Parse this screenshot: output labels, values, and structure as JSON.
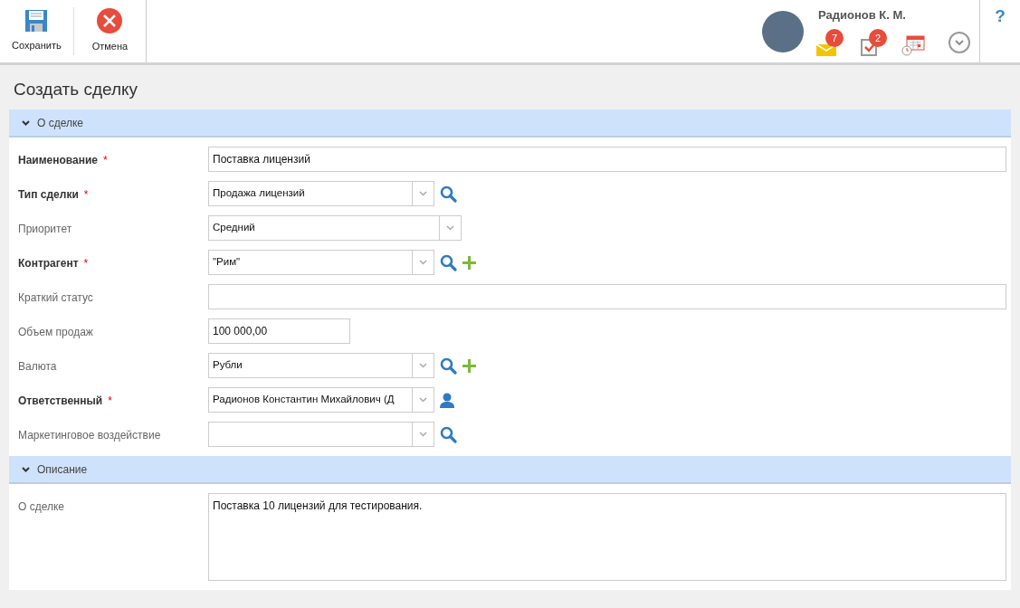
{
  "toolbar": {
    "buttons": [
      {
        "kind": "save",
        "label": "Сохранить"
      },
      {
        "kind": "cancel",
        "label": "Отмена"
      }
    ]
  },
  "user": {
    "name": "Радионов К. М.",
    "notifications": [
      {
        "kind": "mail",
        "count": "7"
      },
      {
        "kind": "tasks",
        "count": "2"
      },
      {
        "kind": "calendar"
      }
    ]
  },
  "help": "?",
  "page_title": "Создать сделку",
  "sections": [
    {
      "title": "О сделке",
      "expanded": true,
      "fields": [
        {
          "label": "Наименование",
          "required": true,
          "required_mark": "*",
          "kind": "text",
          "value": "Поставка лицензий"
        },
        {
          "label": "Тип сделки",
          "required": true,
          "required_mark": "*",
          "kind": "lookup",
          "value": "Продажа лицензий",
          "search_button": true
        },
        {
          "label": "Приоритет",
          "required": false,
          "kind": "select",
          "value": "Средний"
        },
        {
          "label": "Контрагент",
          "required": true,
          "required_mark": "*",
          "kind": "lookup",
          "value": "\"Рим\"",
          "search_button": true,
          "add_button": true
        },
        {
          "label": "Краткий статус",
          "required": false,
          "kind": "text"
        },
        {
          "label": "Объем продаж",
          "required": false,
          "kind": "number",
          "value": "100 000,00"
        },
        {
          "label": "Валюта",
          "required": false,
          "kind": "lookup",
          "value": "Рубли",
          "search_button": true,
          "add_button": true
        },
        {
          "label": "Ответственный",
          "required": true,
          "required_mark": "*",
          "kind": "lookup",
          "value": "Радионов Константин Михайлович (Д",
          "user_button": true
        },
        {
          "label": "Маркетинговое воздействие",
          "required": false,
          "kind": "lookup",
          "search_button": true
        }
      ]
    },
    {
      "title": "Описание",
      "expanded": true,
      "fields": [
        {
          "label": "О сделке",
          "required": false,
          "kind": "textarea",
          "value": "Поставка 10 лицензий для тестирования."
        }
      ]
    }
  ]
}
